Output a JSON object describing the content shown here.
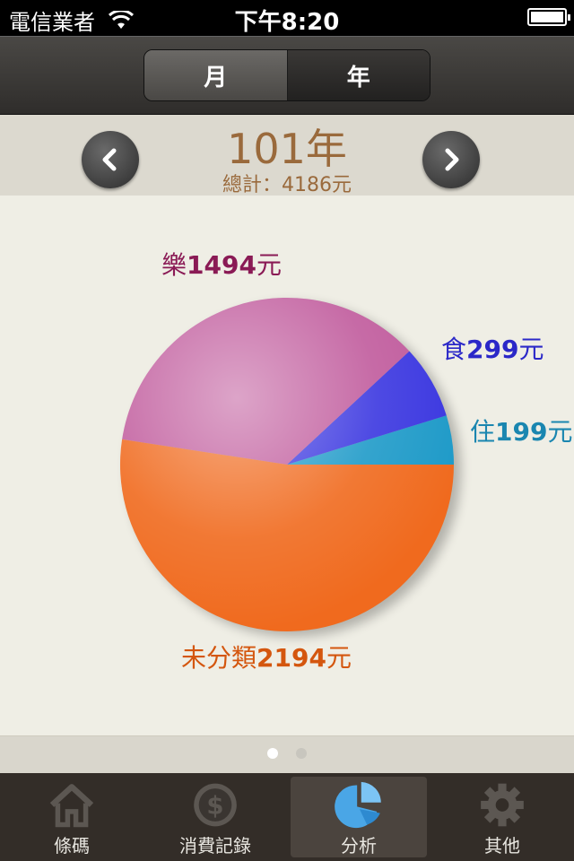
{
  "status_bar": {
    "carrier": "電信業者",
    "time": "下午8:20"
  },
  "nav": {
    "segments": [
      {
        "label": "月",
        "selected": true
      },
      {
        "label": "年",
        "selected": false
      }
    ]
  },
  "header": {
    "title": "101年",
    "total": "總計：4186元",
    "prev_icon": "chevron-left-icon",
    "next_icon": "chevron-right-icon"
  },
  "chart_data": {
    "type": "pie",
    "slices": [
      {
        "name": "樂",
        "value": 1494,
        "unit": "元",
        "color": "#c05a9c",
        "label_color": "#8a1a55"
      },
      {
        "name": "食",
        "value": 299,
        "unit": "元",
        "color": "#3a36e0",
        "label_color": "#2b28c8"
      },
      {
        "name": "住",
        "value": 199,
        "unit": "元",
        "color": "#1e9ac8",
        "label_color": "#1a86b0"
      },
      {
        "name": "未分類",
        "value": 2194,
        "unit": "元",
        "color": "#f06a1e",
        "label_color": "#d4560e"
      }
    ]
  },
  "pager": {
    "pages": 2,
    "current": 1
  },
  "tab_bar": {
    "tabs": [
      {
        "label": "條碼",
        "icon": "house-icon",
        "active": false
      },
      {
        "label": "消費記錄",
        "icon": "dollar-icon",
        "active": false
      },
      {
        "label": "分析",
        "icon": "pie-chart-icon",
        "active": true
      },
      {
        "label": "其他",
        "icon": "gear-icon",
        "active": false
      }
    ]
  }
}
